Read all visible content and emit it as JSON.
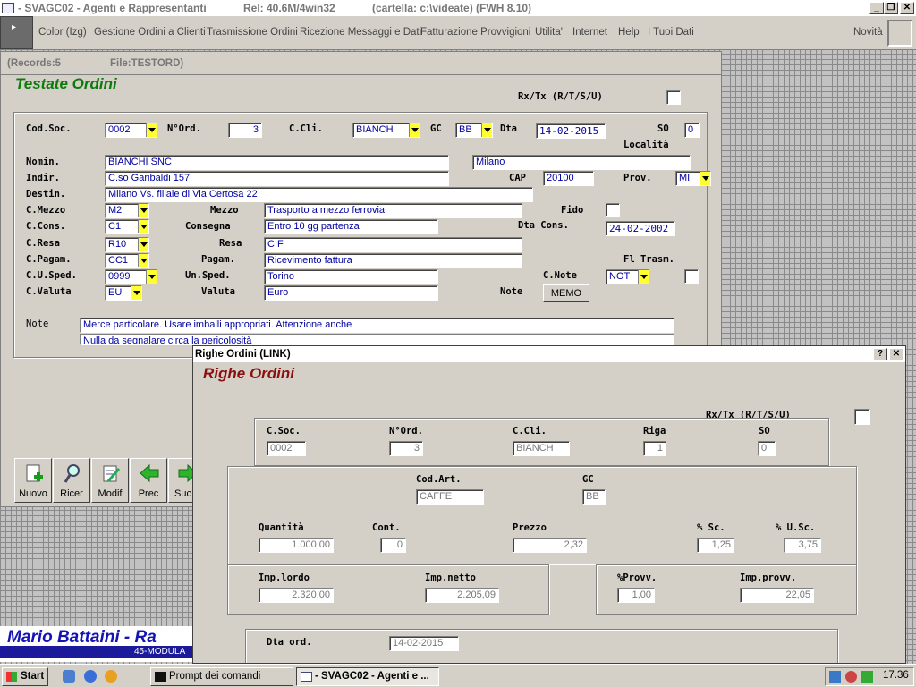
{
  "window": {
    "title": "- SVAGC02 - Agenti e Rappresentanti",
    "rel": "Rel: 40.6M/4win32",
    "folder": "(cartella: c:\\videate) (FWH 8.10)",
    "min_icon": "minimize-icon",
    "max_icon": "restore-icon",
    "close_icon": "close-icon"
  },
  "menu": {
    "items": [
      "Color (Izg)",
      "Gestione Ordini a Clienti",
      "Trasmissione Ordini",
      "Ricezione Messaggi e Dati",
      "Fatturazione Provvigioni",
      "Utilita'",
      "Internet",
      "Help",
      "I Tuoi Dati"
    ],
    "novita": "Novità"
  },
  "main": {
    "records": "(Records:5",
    "file": "File:TESTORD)",
    "title": "Testate Ordini",
    "rxtx": "Rx/Tx (R/T/S/U)",
    "labels": {
      "codsoc": "Cod.Soc.",
      "nord": "N°Ord.",
      "ccli": "C.Cli.",
      "gc": "GC",
      "dta": "Dta",
      "so": "SO",
      "localita": "Località",
      "nomin": "Nomin.",
      "indir": "Indir.",
      "cap": "CAP",
      "prov": "Prov.",
      "destin": "Destin.",
      "cmezzo": "C.Mezzo",
      "mezzo": "Mezzo",
      "fido": "Fido",
      "ccons": "C.Cons.",
      "consegna": "Consegna",
      "dtacons": "Dta Cons.",
      "cresa": "C.Resa",
      "resa": "Resa",
      "cpagam": "C.Pagam.",
      "pagam": "Pagam.",
      "fltrasm": "Fl Trasm.",
      "cusped": "C.U.Sped.",
      "unsped": "Un.Sped.",
      "cnote": "C.Note",
      "cvaluta": "C.Valuta",
      "valuta": "Valuta",
      "note": "Note",
      "note2": "Note"
    },
    "values": {
      "codsoc": "0002",
      "nord": "3",
      "ccli": "BIANCH",
      "gc": "BB",
      "dta": "14-02-2015",
      "so": "0",
      "localita": "Milano",
      "nomin": "BIANCHI SNC",
      "indir": "C.so Garibaldi 157",
      "cap": "20100",
      "prov": "MI",
      "destin": "Milano Vs. filiale di Via Certosa 22",
      "cmezzo": "M2",
      "mezzo": "Trasporto a mezzo ferrovia",
      "ccons": "C1",
      "consegna": "Entro 10 gg partenza",
      "dtacons": "24-02-2002",
      "cresa": "R10",
      "resa": "CIF",
      "cpagam": "CC1",
      "pagam": "Ricevimento fattura",
      "cusped": "0999",
      "unsped": "Torino",
      "cnote": "NOT",
      "cvaluta": "EU",
      "valuta": "Euro",
      "memo": "MEMO",
      "note1": "Merce particolare. Usare imballi appropriati. Attenzione anche",
      "note2": "Nulla da segnalare circa la pericolosità"
    }
  },
  "toolbar": [
    {
      "label": "Nuovo",
      "icon": "new-document-icon"
    },
    {
      "label": "Ricer",
      "icon": "search-icon"
    },
    {
      "label": "Modif",
      "icon": "edit-icon"
    },
    {
      "label": "Prec",
      "icon": "arrow-left-icon"
    },
    {
      "label": "Suc",
      "icon": "arrow-right-icon"
    }
  ],
  "banner": {
    "name": "Mario Battaini - Ra",
    "sub": "45-MODULA"
  },
  "dialog": {
    "title": "Righe Ordini (LINK)",
    "help_icon": "help-icon",
    "close_icon": "close-icon",
    "heading": "Righe Ordini",
    "rxtx": "Rx/Tx (R/T/S/U)",
    "labels": {
      "csoc": "C.Soc.",
      "nord": "N°Ord.",
      "ccli": "C.Cli.",
      "riga": "Riga",
      "so": "SO",
      "codart": "Cod.Art.",
      "gc": "GC",
      "quantita": "Quantità",
      "cont": "Cont.",
      "prezzo": "Prezzo",
      "sc": "% Sc.",
      "usc": "% U.Sc.",
      "implordo": "Imp.lordo",
      "impnetto": "Imp.netto",
      "provv": "%Provv.",
      "impprovv": "Imp.provv.",
      "dtaord": "Dta ord."
    },
    "values": {
      "csoc": "0002",
      "nord": "3",
      "ccli": "BIANCH",
      "riga": "1",
      "so": "0",
      "codart": "CAFFE",
      "gc": "BB",
      "quantita": "1.000,00",
      "cont": "0",
      "prezzo": "2,32",
      "sc": "1,25",
      "usc": "3,75",
      "implordo": "2.320,00",
      "impnetto": "2.205,09",
      "provv": "1,00",
      "impprovv": "22,05",
      "dtaord": "14-02-2015"
    }
  },
  "taskbar": {
    "start": "Start",
    "tasks": [
      "Prompt dei comandi",
      "- SVAGC02 - Agenti e ..."
    ],
    "clock": "17.36"
  }
}
